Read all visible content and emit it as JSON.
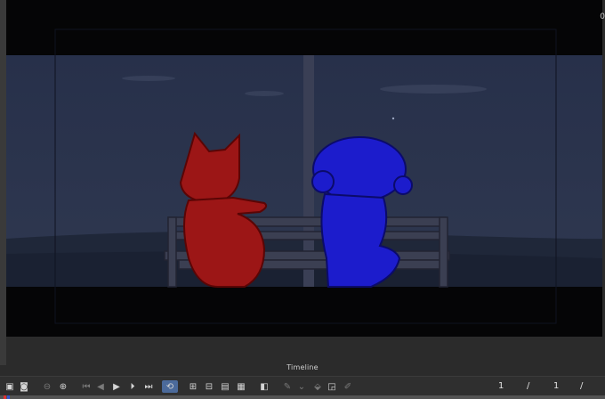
{
  "corner_mark": "0",
  "timeline": {
    "label": "Timeline",
    "frame_current": "1",
    "separator": "/",
    "frame_total": "1",
    "trailing_separator": "/"
  },
  "icons": {
    "scene": "scene-icon",
    "camera": "camera-icon",
    "zoom_out": "zoom-out-icon",
    "zoom_in": "zoom-in-icon",
    "first_frame": "first-frame-icon",
    "prev_frame": "previous-frame-icon",
    "play": "play-icon",
    "next_frame": "next-frame-icon",
    "last_frame": "last-frame-icon",
    "loop": "loop-icon",
    "new_cel": "new-cel-icon",
    "new_frame": "new-frame-icon",
    "layer": "layer-icon",
    "image": "image-icon",
    "onion": "onion-skin-icon",
    "brush": "brush-icon",
    "chevron": "chevron-down-icon",
    "fill": "fill-icon",
    "vector": "vector-icon",
    "pen": "pen-icon"
  },
  "colors": {
    "fox": "#a01a1a",
    "bear": "#1a1ad0",
    "sky": "#2a3347",
    "loop_active": "#4b6a9b"
  }
}
